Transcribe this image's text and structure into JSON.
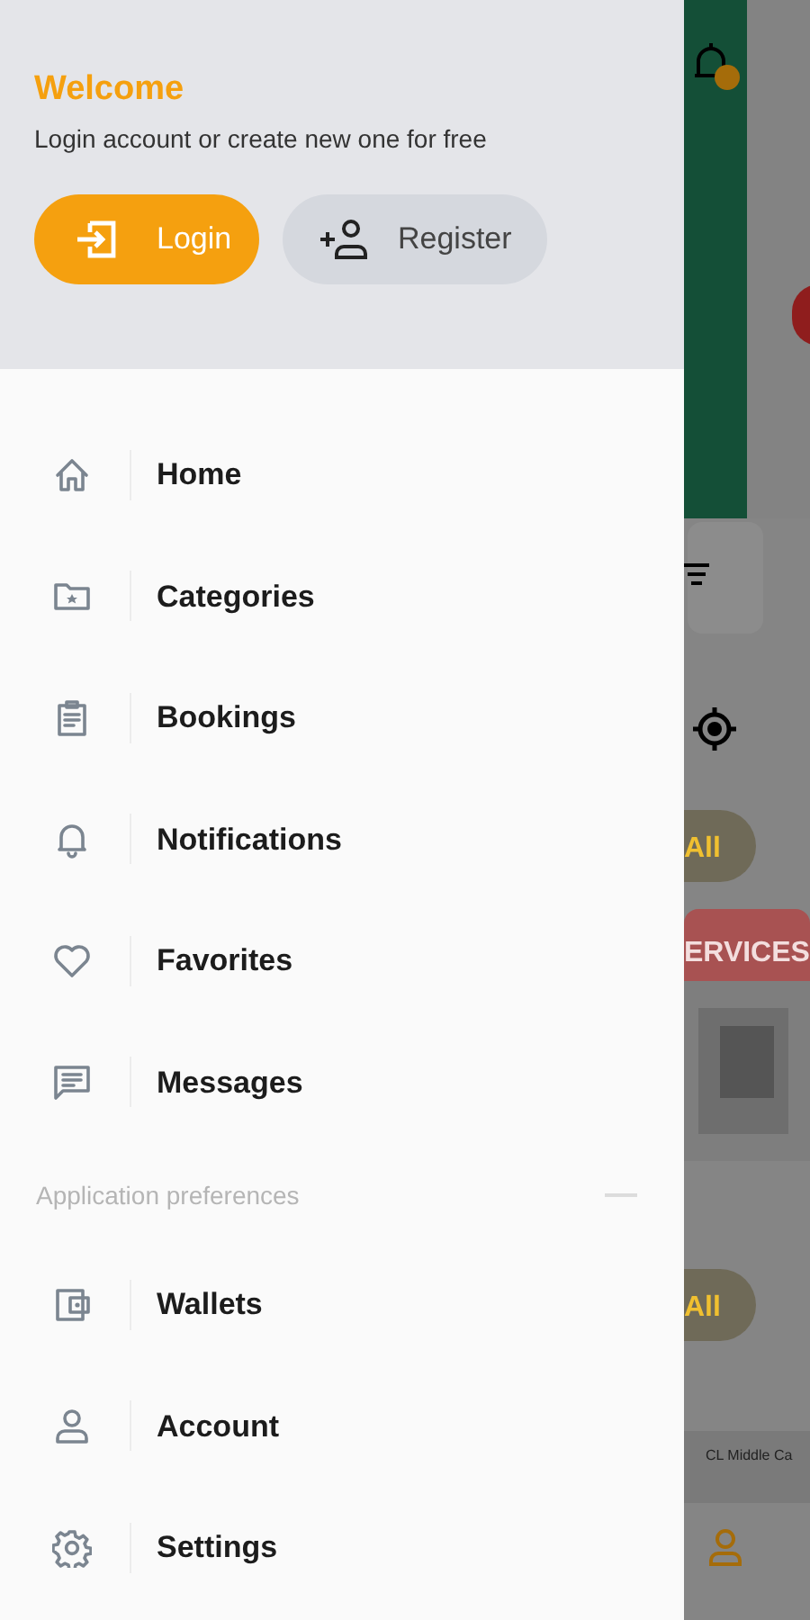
{
  "drawer": {
    "header": {
      "title": "Welcome",
      "subtitle": "Login account or create new one for free",
      "buttons": [
        {
          "label": "Login",
          "kind": "primary"
        },
        {
          "label": "Register",
          "kind": "secondary"
        }
      ]
    },
    "main_items": [
      {
        "label": "Home"
      },
      {
        "label": "Categories"
      },
      {
        "label": "Bookings"
      },
      {
        "label": "Notifications"
      },
      {
        "label": "Favorites"
      },
      {
        "label": "Messages"
      }
    ],
    "section": {
      "label": "Application preferences"
    },
    "preference_items": [
      {
        "label": "Wallets"
      },
      {
        "label": "Account"
      },
      {
        "label": "Settings"
      }
    ]
  },
  "background_screen": {
    "view_all_1": "All",
    "banner": "ERVICES",
    "view_all_2": "All",
    "card_caption": "CL Middle Ca"
  }
}
